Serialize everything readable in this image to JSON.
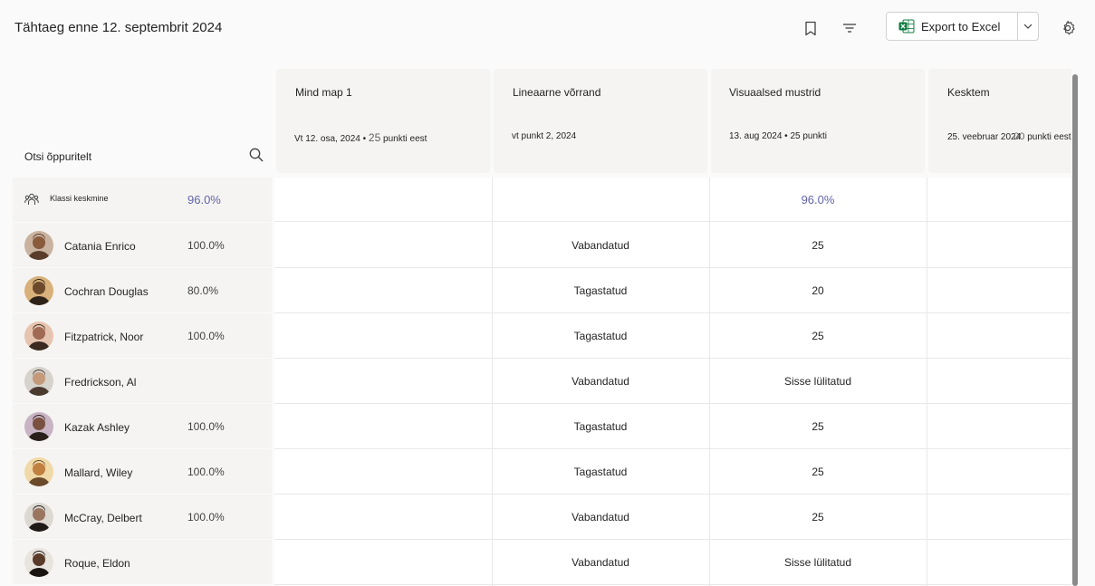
{
  "header": {
    "title": "Tähtaeg enne 12. septembrit 2024",
    "export_label": "Export to Excel"
  },
  "search": {
    "label": "Otsi õppuritelt"
  },
  "assignments": [
    {
      "name": "Mind map 1",
      "meta_a": "Vt 12. osa, 2024 •",
      "meta_b": "25",
      "meta_c": "punkti eest"
    },
    {
      "name": "Lineaarne võrrand",
      "meta_a": "vt punkt 2, 2024",
      "meta_b": "",
      "meta_c": ""
    },
    {
      "name": "Visuaalsed mustrid",
      "meta_a": "13. aug 2024 • 25 punkti",
      "meta_b": "",
      "meta_c": ""
    },
    {
      "name": "Kesktem",
      "meta_a": "25. veebruar 2024",
      "meta_b": "00",
      "meta_c": "punkti eest"
    }
  ],
  "class_average": {
    "label": "Klassi keskmine",
    "value": "96.0%",
    "cells": [
      "",
      "",
      "96.0%",
      ""
    ]
  },
  "students": [
    {
      "name": "Catania Enrico",
      "pct": "100.0%",
      "cells": [
        "",
        "Vabandatud",
        "25",
        ""
      ]
    },
    {
      "name": "Cochran Douglas",
      "pct": "80.0%",
      "cells": [
        "",
        "Tagastatud",
        "20",
        ""
      ]
    },
    {
      "name": "Fitzpatrick, Noor",
      "pct": "100.0%",
      "cells": [
        "",
        "Tagastatud",
        "25",
        ""
      ]
    },
    {
      "name": "Fredrickson, Al",
      "pct": "",
      "cells": [
        "",
        "Vabandatud",
        "Sisse lülitatud",
        ""
      ]
    },
    {
      "name": "Kazak Ashley",
      "pct": "100.0%",
      "cells": [
        "",
        "Tagastatud",
        "25",
        ""
      ]
    },
    {
      "name": "Mallard, Wiley",
      "pct": "100.0%",
      "cells": [
        "",
        "Tagastatud",
        "25",
        ""
      ]
    },
    {
      "name": "McCray, Delbert",
      "pct": "100.0%",
      "cells": [
        "",
        "Vabandatud",
        "25",
        ""
      ]
    },
    {
      "name": "Roque, Eldon",
      "pct": "",
      "cells": [
        "",
        "Vabandatud",
        "Sisse lülitatud",
        ""
      ]
    }
  ],
  "colors": {
    "accent": "#6264a7",
    "header_bg": "#f5f4f2",
    "excel_green": "#107c41"
  },
  "icons": [
    "bookmark-icon",
    "filter-icon",
    "excel-icon",
    "chevron-down-icon",
    "gear-icon",
    "search-icon",
    "people-icon"
  ]
}
